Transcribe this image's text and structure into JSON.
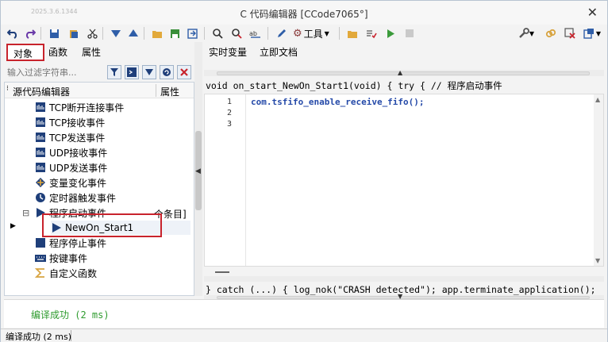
{
  "window": {
    "timestamp": "2025.3.6.1344",
    "title": "C 代码编辑器 [CCode7065°]",
    "close_glyph": "✕"
  },
  "toolbar": {
    "tools_label": "工具"
  },
  "left_panel": {
    "tabs": [
      "对象",
      "函数",
      "属性"
    ],
    "active_tab": "对象",
    "filter_placeholder": "输入过滤字符串...",
    "tree_header": {
      "name": "源代码编辑器",
      "property": "属性"
    },
    "items": [
      {
        "label": "TCP断开连接事件",
        "icon": "grid-icon"
      },
      {
        "label": "TCP接收事件",
        "icon": "grid-icon"
      },
      {
        "label": "TCP发送事件",
        "icon": "grid-icon"
      },
      {
        "label": "UDP接收事件",
        "icon": "grid-icon"
      },
      {
        "label": "UDP发送事件",
        "icon": "grid-icon"
      },
      {
        "label": "变量变化事件",
        "icon": "variable-icon"
      },
      {
        "label": "定时器触发事件",
        "icon": "clock-icon"
      },
      {
        "label": "程序启动事件",
        "icon": "play-icon",
        "expanded": true,
        "property": "个条目]"
      },
      {
        "label": "NewOn_Start1",
        "icon": "play-icon",
        "child": true,
        "selected": true
      },
      {
        "label": "程序停止事件",
        "icon": "stop-icon"
      },
      {
        "label": "按键事件",
        "icon": "keyboard-icon"
      },
      {
        "label": "自定义函数",
        "icon": "sigma-icon"
      }
    ]
  },
  "right_panel": {
    "tabs": [
      "实时变量",
      "立即文档"
    ],
    "signature": "void on_start_NewOn_Start1(void) { try { // 程序启动事件",
    "code_lines": [
      {
        "n": "1",
        "text": "com.tsfifo_enable_receive_fifo();"
      },
      {
        "n": "2",
        "text": ""
      },
      {
        "n": "3",
        "text": ""
      }
    ],
    "catch_line": "} catch (...) { log_nok(\"CRASH detected\"); app.terminate_application();"
  },
  "output": {
    "message": "编译成功 (2 ms)"
  },
  "status_bar": {
    "text": "编译成功 (2 ms)"
  },
  "colors": {
    "highlight_red": "#c8232c",
    "code_blue": "#2449a8",
    "success_green": "#2e9b2e",
    "icon_navy": "#1f3f7a"
  }
}
